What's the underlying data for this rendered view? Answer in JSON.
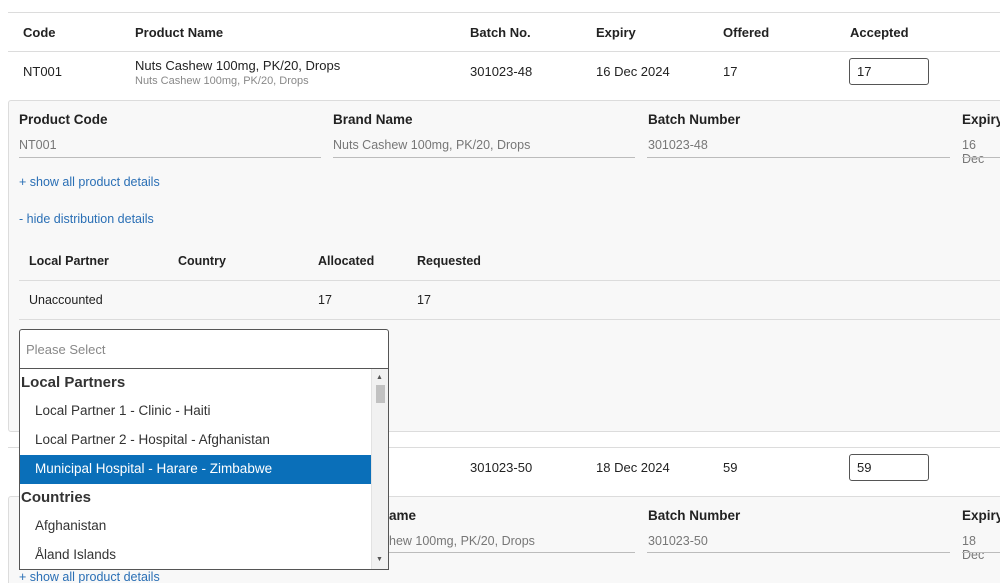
{
  "table": {
    "headers": {
      "code": "Code",
      "product_name": "Product Name",
      "batch_no": "Batch No.",
      "expiry": "Expiry",
      "offered": "Offered",
      "accepted": "Accepted"
    },
    "rows": [
      {
        "code": "NT001",
        "product_name": "Nuts Cashew 100mg, PK/20, Drops",
        "product_sub": "Nuts Cashew 100mg, PK/20, Drops",
        "batch_no": "301023-48",
        "expiry": "16 Dec 2024",
        "offered": "17",
        "accepted": "17"
      },
      {
        "batch_no": "301023-50",
        "expiry": "18 Dec 2024",
        "offered": "59",
        "accepted": "59"
      }
    ]
  },
  "details_panel_1": {
    "product_code_label": "Product Code",
    "product_code_value": "NT001",
    "brand_name_label": "Brand Name",
    "brand_name_value": "Nuts Cashew 100mg, PK/20, Drops",
    "batch_number_label": "Batch Number",
    "batch_number_value": "301023-48",
    "expiry_label": "Expiry",
    "expiry_value": "16 Dec",
    "show_product_details": "+ show all product details",
    "hide_distribution_details": "- hide distribution details",
    "distribution": {
      "headers": {
        "local_partner": "Local Partner",
        "country": "Country",
        "allocated": "Allocated",
        "requested": "Requested"
      },
      "rows": [
        {
          "local_partner": "Unaccounted",
          "country": "",
          "allocated": "17",
          "requested": "17"
        }
      ]
    }
  },
  "details_panel_2": {
    "brand_name_label_partial": "ame",
    "brand_name_value_partial": "hew 100mg, PK/20, Drops",
    "batch_number_label": "Batch Number",
    "batch_number_value": "301023-50",
    "expiry_label": "Expiry",
    "expiry_value": "18 Dec",
    "show_product_details": "+ show all product details"
  },
  "dropdown": {
    "placeholder": "Please Select",
    "groups": [
      {
        "label": "Local Partners",
        "options": [
          "Local Partner 1 - Clinic - Haiti",
          "Local Partner 2 - Hospital - Afghanistan",
          "Municipal Hospital - Harare - Zimbabwe"
        ]
      },
      {
        "label": "Countries",
        "options": [
          "Afghanistan",
          "Åland Islands"
        ]
      }
    ],
    "selected": "Municipal Hospital - Harare - Zimbabwe"
  },
  "colors": {
    "selected_bg": "#0a6fb9",
    "link": "#2a6fb5"
  }
}
